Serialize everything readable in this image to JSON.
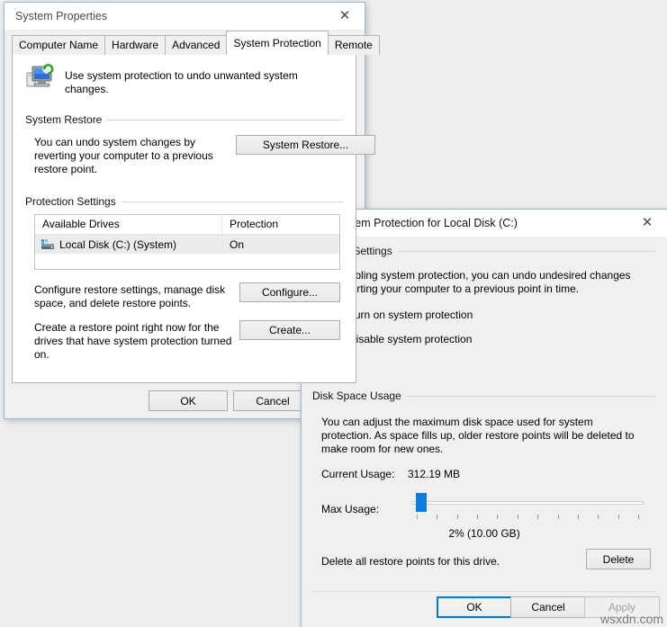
{
  "desktop": {
    "background_color": "#eeeeee",
    "watermark": "wsxdn.com"
  },
  "system_properties": {
    "title": "System Properties",
    "close_label": "✕",
    "tabs": [
      {
        "label": "Computer Name",
        "active": false
      },
      {
        "label": "Hardware",
        "active": false
      },
      {
        "label": "Advanced",
        "active": false
      },
      {
        "label": "System Protection",
        "active": true
      },
      {
        "label": "Remote",
        "active": false
      }
    ],
    "header_text": "Use system protection to undo unwanted system changes.",
    "system_restore": {
      "group_label": "System Restore",
      "description": "You can undo system changes by reverting your computer to a previous restore point.",
      "button_label": "System Restore..."
    },
    "protection_settings": {
      "group_label": "Protection Settings",
      "columns": [
        "Available Drives",
        "Protection"
      ],
      "rows": [
        {
          "drive": "Local Disk (C:) (System)",
          "protection": "On",
          "selected": true
        }
      ],
      "configure_description": "Configure restore settings, manage disk space, and delete restore points.",
      "configure_button": "Configure...",
      "create_description": "Create a restore point right now for the drives that have system protection turned on.",
      "create_button": "Create..."
    },
    "footer": {
      "ok": "OK",
      "cancel": "Cancel"
    }
  },
  "system_protection_dialog": {
    "title": "System Protection for Local Disk (C:)",
    "close_label": "✕",
    "restore_settings": {
      "group_label": "Restore Settings",
      "description": "By enabling system protection, you can undo undesired changes by reverting your computer to a previous point in time.",
      "options": [
        {
          "label": "Turn on system protection",
          "checked": true
        },
        {
          "label": "Disable system protection",
          "checked": false
        }
      ]
    },
    "disk_space_usage": {
      "group_label": "Disk Space Usage",
      "description": "You can adjust the maximum disk space used for system protection. As space fills up, older restore points will be deleted to make room for new ones.",
      "current_usage_label": "Current Usage:",
      "current_usage_value": "312.19 MB",
      "max_usage_label": "Max Usage:",
      "slider_percent": 2,
      "slider_value_text": "2% (10.00 GB)",
      "slider_tick_count": 12,
      "accent_color": "#0a7fdd"
    },
    "delete_section": {
      "description": "Delete all restore points for this drive.",
      "button_label": "Delete"
    },
    "footer": {
      "ok": "OK",
      "cancel": "Cancel",
      "apply": "Apply",
      "apply_disabled": true
    }
  }
}
